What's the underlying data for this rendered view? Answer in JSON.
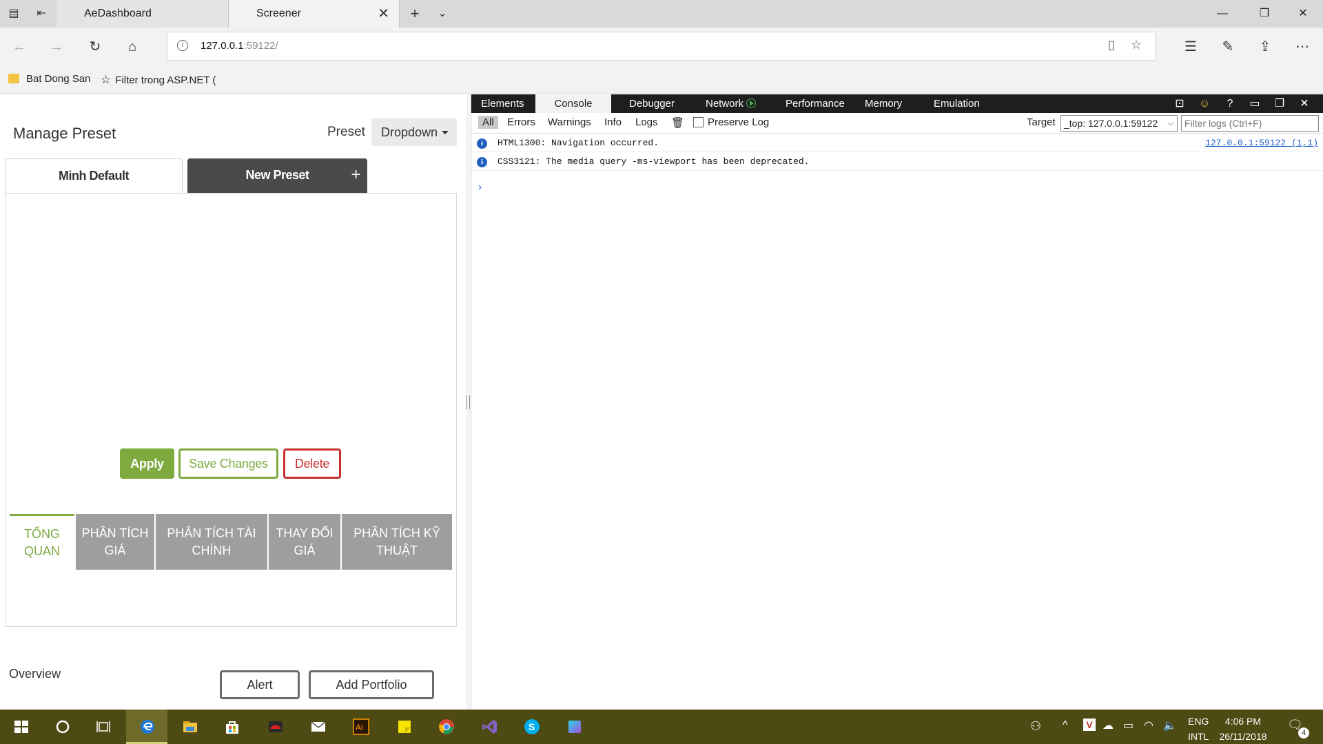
{
  "browser": {
    "tabs": [
      {
        "title": "AeDashboard",
        "active": false
      },
      {
        "title": "Screener",
        "active": true
      }
    ],
    "url_host": "127.0.0.1",
    "url_port": ":59122/",
    "favorites": [
      "Bat Dong San",
      "Filter trong ASP.NET ("
    ]
  },
  "page": {
    "title": "Manage Preset",
    "preset_label": "Preset",
    "dropdown_label": "Dropdown",
    "preset_tabs": [
      "Minh Default",
      "New Preset"
    ],
    "new_preset_icon": "plus-icon",
    "buttons": {
      "apply": "Apply",
      "save": "Save Changes",
      "delete": "Delete"
    },
    "section_tabs": [
      "TỔNG QUAN",
      "PHÂN TÍCH GIÁ",
      "PHÂN TÍCH TÀI CHÍNH",
      "THAY ĐỔI GIÁ",
      "PHÂN TÍCH KỸ THUẬT"
    ],
    "overview_label": "Overview",
    "alert_button": "Alert",
    "add_portfolio_button": "Add Portfolio",
    "colors": {
      "accent_green": "#7eaa3f",
      "danger_red": "#c9302c",
      "tab_gray": "#9e9e9e",
      "dark_tab": "#4a4a4a"
    }
  },
  "devtools": {
    "tabs": [
      "Elements",
      "Console",
      "Debugger",
      "Network",
      "Performance",
      "Memory",
      "Emulation"
    ],
    "active_tab": "Console",
    "filters": [
      "All",
      "Errors",
      "Warnings",
      "Info",
      "Logs"
    ],
    "preserve_log": "Preserve Log",
    "target_label": "Target",
    "target_value": "_top: 127.0.0.1:59122",
    "filter_placeholder": "Filter logs (Ctrl+F)",
    "messages": [
      {
        "text": "HTML1300: Navigation occurred.",
        "source": "127.0.0.1:59122 (1,1)"
      },
      {
        "text": "CSS3121: The media query -ms-viewport has been deprecated.",
        "source": ""
      }
    ],
    "prompt": "›"
  },
  "taskbar": {
    "lang_top": "ENG",
    "lang_bottom": "INTL",
    "time": "4:06 PM",
    "date": "26/11/2018",
    "notification_count": "4",
    "color": "#4e4a14"
  }
}
